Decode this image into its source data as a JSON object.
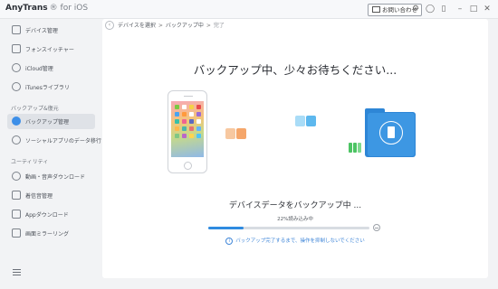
{
  "titlebar": {
    "app_name": "AnyTrans",
    "app_suffix": "® for iOS",
    "contact_label": "お問い合わせ"
  },
  "sidebar": {
    "items_top": [
      {
        "label": "デバイス管理",
        "icon": "device-icon"
      },
      {
        "label": "フォンスイッチャー",
        "icon": "phone-switcher-icon"
      },
      {
        "label": "iCloud管理",
        "icon": "icloud-icon"
      },
      {
        "label": "iTunesライブラリ",
        "icon": "itunes-icon"
      }
    ],
    "section_backup": "バックアップ&復元",
    "items_backup": [
      {
        "label": "バックアップ管理",
        "icon": "backup-icon",
        "active": true
      },
      {
        "label": "ソーシャルアプリのデータ移行",
        "icon": "social-app-icon"
      }
    ],
    "section_utility": "ユーティリティ",
    "items_utility": [
      {
        "label": "動画・音声ダウンロード",
        "icon": "download-icon"
      },
      {
        "label": "着信音管理",
        "icon": "ringtone-icon"
      },
      {
        "label": "Appダウンロード",
        "icon": "app-download-icon"
      },
      {
        "label": "画面ミラーリング",
        "icon": "screen-mirror-icon"
      }
    ]
  },
  "breadcrumb": {
    "step1": "デバイスを選択",
    "step2": "バックアップ中",
    "step3": "完了",
    "separator": ">"
  },
  "main": {
    "heading": "バックアップ中、少々お待ちください...",
    "progress_title": "デバイスデータをバックアップ中 ...",
    "progress_status": "22%読み込み中",
    "progress_fraction": 0.22,
    "info_text": "バックアップ完了するまで、操作を抑制しないでください"
  },
  "colors": {
    "accent": "#2f8be0",
    "folder": "#3d97e3",
    "plug": "#4cc463",
    "block_orange": "#f7b27a",
    "block_blue": "#6fc0ee"
  }
}
